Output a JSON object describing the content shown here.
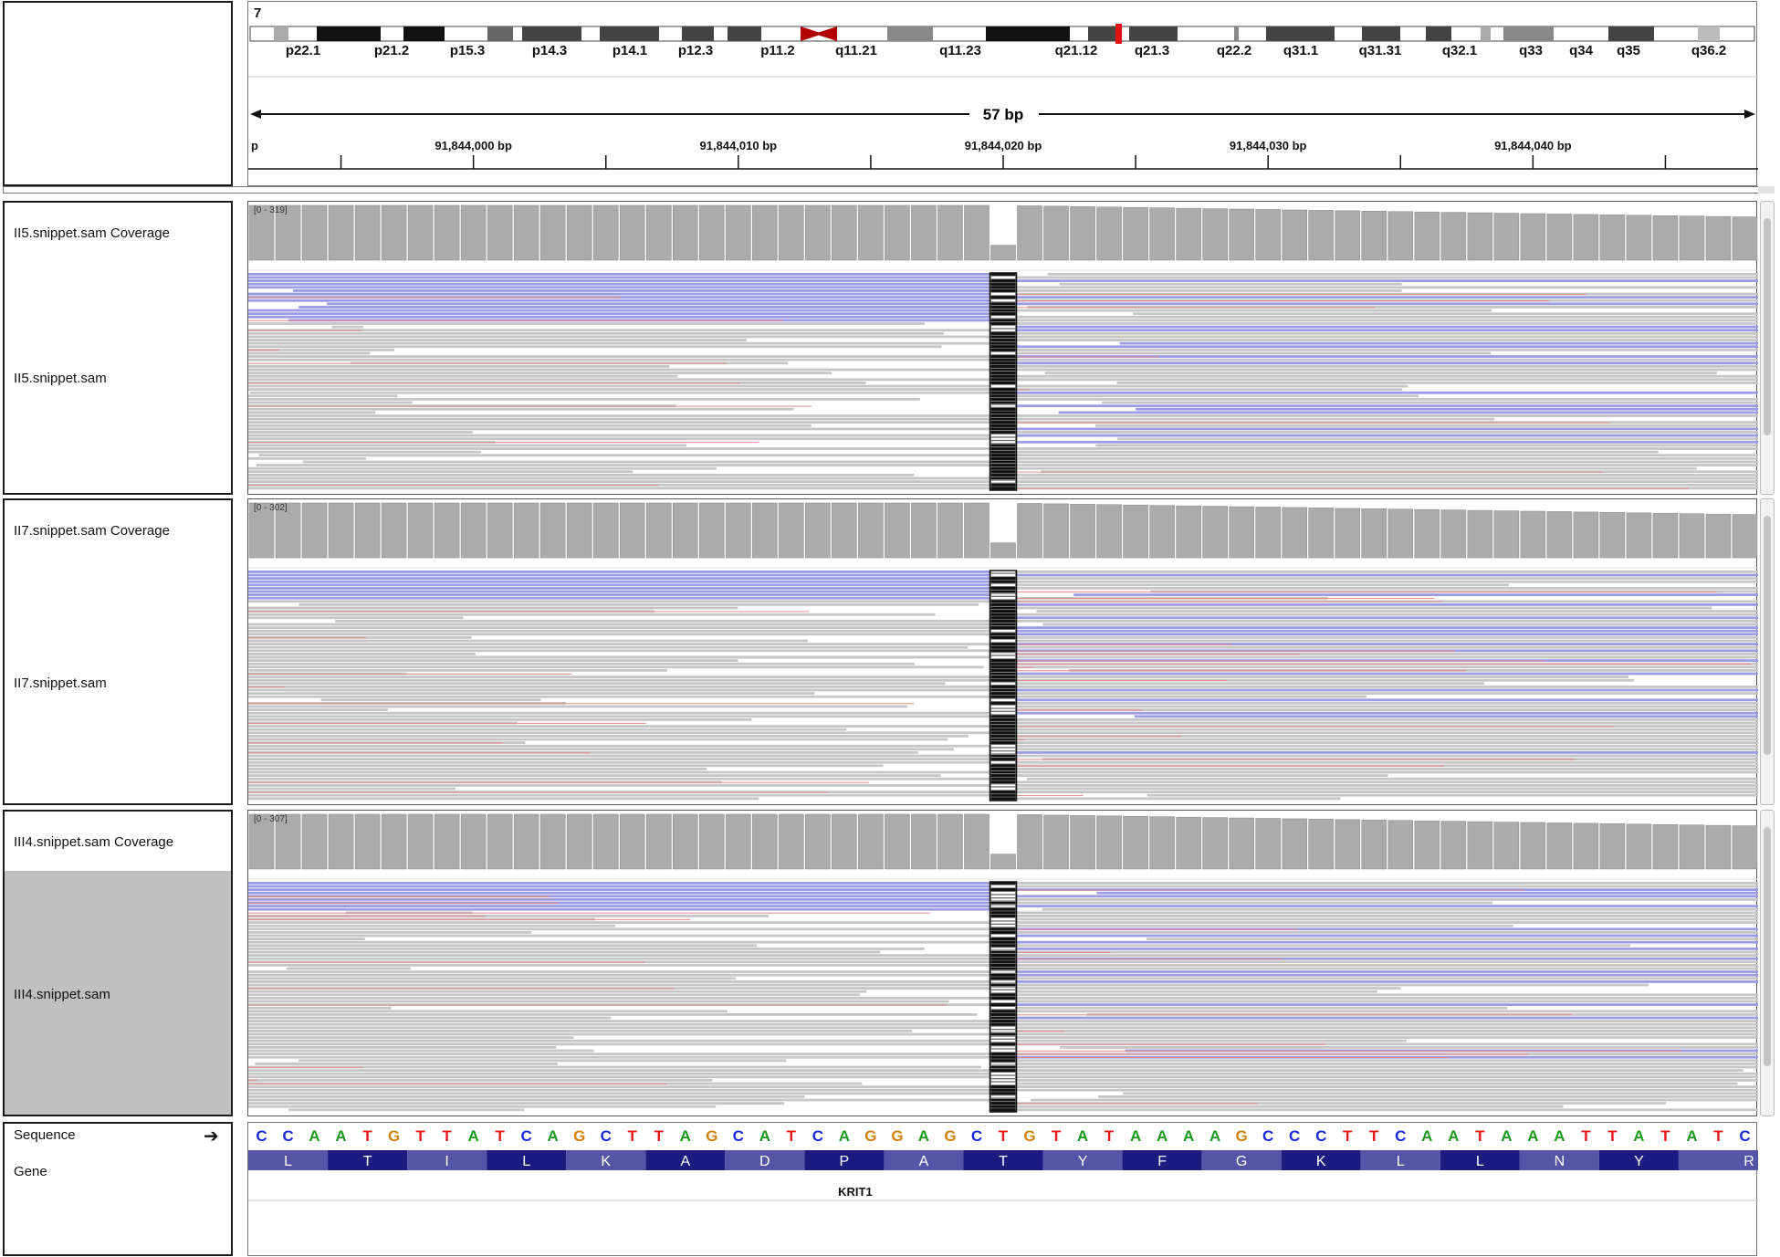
{
  "header": {
    "chromosome": "7",
    "bands": [
      "p22.1",
      "p21.2",
      "p15.3",
      "p14.3",
      "p14.1",
      "p12.3",
      "p11.2",
      "q11.21",
      "q11.23",
      "q21.12",
      "q21.3",
      "q22.2",
      "q31.1",
      "q31.31",
      "q32.1",
      "q33",
      "q34",
      "q35",
      "q36.2"
    ],
    "span_label": "57 bp",
    "ticks": [
      {
        "label": "p",
        "bp": 91843996
      },
      {
        "label": "91,844,000 bp",
        "bp": 91844000
      },
      {
        "label": "91,844,010 bp",
        "bp": 91844010
      },
      {
        "label": "91,844,020 bp",
        "bp": 91844020
      },
      {
        "label": "91,844,030 bp",
        "bp": 91844030
      },
      {
        "label": "91,844,040 bp",
        "bp": 91844040
      }
    ]
  },
  "tracks": [
    {
      "coverage_name": "II5.snippet.sam Coverage",
      "reads_name": "II5.snippet.sam",
      "range": "[0 - 319]"
    },
    {
      "coverage_name": "II7.snippet.sam Coverage",
      "reads_name": "II7.snippet.sam",
      "range": "[0 - 302]"
    },
    {
      "coverage_name": "III4.snippet.sam Coverage",
      "reads_name": "III4.snippet.sam",
      "range": "[0 - 307]",
      "selected": true
    }
  ],
  "sequence": {
    "label": "Sequence",
    "strand_icon": "arrow-right-icon",
    "bases": "CCAATGTTATCAGCTTAGCATCAGGAGCTGTATAAAAGCCCTTCAATAAATTATATC"
  },
  "gene": {
    "label": "Gene",
    "amino_acids": [
      "L",
      "T",
      "I",
      "L",
      "K",
      "A",
      "D",
      "P",
      "A",
      "T",
      "Y",
      "F",
      "G",
      "K",
      "L",
      "L",
      "N",
      "Y",
      "R"
    ],
    "name": "KRIT1"
  },
  "colors": {
    "A": "#1c9a1c",
    "C": "#1a2ad6",
    "G": "#d0820c",
    "T": "#e21a1a",
    "read_gray": "#c6c6c6",
    "read_blue": "#9b9ce6",
    "mismatch_red": "#e88a8a",
    "coverage_gray": "#ababab",
    "gene_dark": "#1b1b80",
    "gene_light": "#5555a8"
  }
}
